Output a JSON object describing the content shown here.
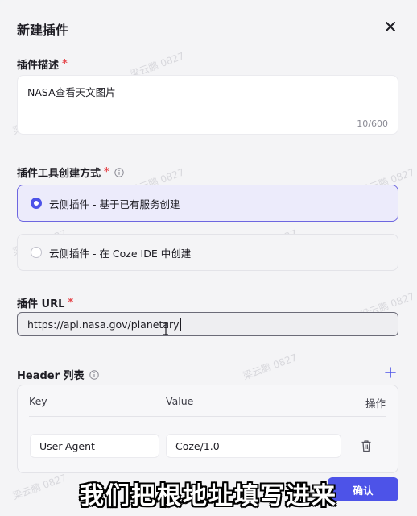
{
  "dialog": {
    "title": "新建插件"
  },
  "description": {
    "label": "插件描述",
    "required_mark": "*",
    "value": "NASA查看天文图片",
    "counter": "10/600"
  },
  "creation_method": {
    "label": "插件工具创建方式",
    "required_mark": "*",
    "options": [
      {
        "label": "云侧插件 - 基于已有服务创建",
        "selected": true
      },
      {
        "label": "云侧插件 - 在 Coze IDE 中创建",
        "selected": false
      }
    ]
  },
  "url": {
    "label": "插件 URL",
    "required_mark": "*",
    "value": "https://api.nasa.gov/planetary"
  },
  "headers": {
    "label": "Header 列表",
    "columns": [
      "Key",
      "Value",
      "操作"
    ],
    "rows": [
      {
        "key": "User-Agent",
        "value": "Coze/1.0"
      }
    ]
  },
  "footer": {
    "confirm_label": "确认"
  },
  "subtitle": "我们把根地址填写进来",
  "watermark": "梁云鹏 0827",
  "colors": {
    "accent": "#4d53e8",
    "required": "#e5484d",
    "selected_bg": "#ecebfb"
  }
}
